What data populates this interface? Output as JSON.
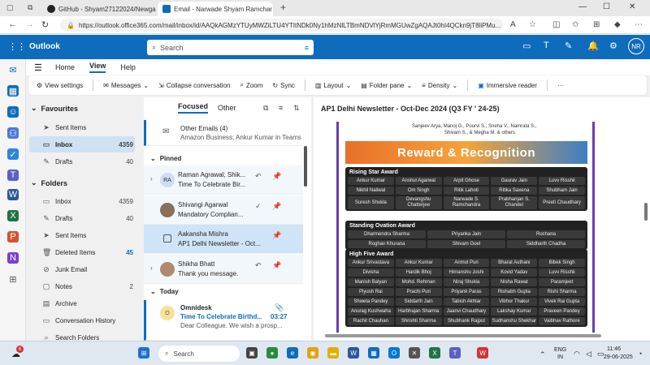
{
  "browser": {
    "tabs": [
      {
        "label": "GitHub - Shyam27122024/Newga",
        "icon": "github-icon"
      },
      {
        "label": "Email - Narwade Shyam Ramchar",
        "icon": "outlook-icon"
      }
    ],
    "new_tab": "+",
    "url": "https://outlook.office365.com/mail/inbox/id/AAQkAGMzYTUyMWZiLTU4YTItNDk0Ny1hMzNlLTBmNDVlYjRmMGUwZgAQAJt0hI4QCkn9jT8liPMu...",
    "window_controls": [
      "—",
      "☐",
      "✕"
    ]
  },
  "outlook": {
    "app_name": "Outlook",
    "search_placeholder": "Search",
    "avatar_initials": "NR",
    "ribbon_tabs": [
      "Home",
      "View",
      "Help"
    ],
    "active_ribbon_tab": "View",
    "ribbon_buttons": [
      "View settings",
      "Messages",
      "Collapse conversation",
      "Zoom",
      "Sync",
      "Layout",
      "Folder pane",
      "Density",
      "Immersive reader"
    ],
    "more": "···"
  },
  "folders": {
    "favourites_title": "Favourites",
    "favourites": [
      {
        "label": "Sent Items",
        "count": ""
      },
      {
        "label": "Inbox",
        "count": "4359"
      },
      {
        "label": "Drafts",
        "count": "40"
      }
    ],
    "folders_title": "Folders",
    "folders": [
      {
        "label": "Inbox",
        "count": "4359"
      },
      {
        "label": "Drafts",
        "count": "40"
      },
      {
        "label": "Sent Items",
        "count": ""
      },
      {
        "label": "Deleted Items",
        "count": "45"
      },
      {
        "label": "Junk Email",
        "count": ""
      },
      {
        "label": "Notes",
        "count": "2"
      },
      {
        "label": "Archive",
        "count": ""
      },
      {
        "label": "Conversation History",
        "count": ""
      },
      {
        "label": "Search Folders",
        "count": ""
      }
    ]
  },
  "message_list": {
    "tabs": [
      "Focused",
      "Other"
    ],
    "other_emails": {
      "sender": "Other Emails (4)",
      "preview": "Amazon Business; Ankur Kumar in Teams"
    },
    "pinned_label": "Pinned",
    "pinned": [
      {
        "sender": "Raman Agrawal; Shik...",
        "subject": "Time To Celebrate Bir...",
        "initials": "RA"
      },
      {
        "sender": "Shivangi Agarwal",
        "subject": "Mandatory Complian...",
        "initials": ""
      },
      {
        "sender": "Aakansha Mishra",
        "subject": "AP1 Delhi Newsletter - Oct...",
        "initials": ""
      },
      {
        "sender": "Shikha Bhatt",
        "subject": "Thank you message.",
        "initials": ""
      }
    ],
    "today_label": "Today",
    "today": [
      {
        "sender": "Omnidesk",
        "subject": "Time To Celebrate Birthd...",
        "time": "03:27",
        "preview": "Dear Colleague. We wish a prosp...",
        "initials": "O"
      }
    ]
  },
  "reader": {
    "title": "AP1 Delhi Newsletter - Oct-Dec 2024 (Q3 FY ' 24-25)",
    "top_names": [
      "Sanjeev Arya, Manoj G., Poorvi S., Sneha V., Namrata S.,",
      "Shivam S., & Megha M. & others"
    ],
    "banner": "Reward & Recognition",
    "rising_star": {
      "title": "Rising Star Award",
      "names": [
        "Ankur Kumar",
        "Anshul Agarwal",
        "Arpit Ghose",
        "Gaurav Jain",
        "Luvv Risshii",
        "Nikhil Naliwal",
        "Om Singh",
        "Ritik Lahoti",
        "Ritika Saxena",
        "Shubham Jain",
        "Suresh Shukla",
        "Devangshu Chatterjee",
        "Narwade S. Ramchandra",
        "Prabhanjan S. Chandel",
        "Preeti Chaudhary"
      ]
    },
    "standing_ovation": {
      "title": "Standing Ovation Award",
      "names": [
        "Dharmendra Sharma",
        "Priyanka Jain",
        "Rochana",
        "Roghav Khurana",
        "Shivam Goel",
        "Siddharth Chadha"
      ]
    },
    "high_five": {
      "title": "High Five Award",
      "names": [
        "Ankur Srivastava",
        "Ankur Kumar",
        "Anmol Puri",
        "Bharat Authani",
        "Bibek Singh",
        "Divisha",
        "Hardik Bhoj",
        "Himanshu Joshi",
        "Kovid Yadav",
        "Luvv Risshii",
        "Manish Balyan",
        "Mohd. Rehman",
        "Niraj Shukla",
        "Nisha Rawat",
        "Paramjeet",
        "Piyush Rai",
        "Prachi Puri",
        "Priyank Paras",
        "Rishabh Gupta",
        "Rishi Sharma",
        "Shweta Pandey",
        "Siddarth Jain",
        "Tabish Akhtar",
        "Vibhor Thakur",
        "Vivek Rai Gupta",
        "Anurag Kushwaha",
        "Harbhajan Sharma",
        "Jaanvi Chaudhary",
        "Lakshay Kumar",
        "Praveen Pandey",
        "Rachit Chauhan",
        "Shrishti Sharma",
        "Shubhank Rajput",
        "Sudhanshu Shekhar",
        "Vaibhav Rathore"
      ]
    }
  },
  "taskbar": {
    "notification_count": "6",
    "search_placeholder": "Search",
    "lang": "ENG",
    "region": "IN",
    "time": "11:46",
    "date": "29-06-2025"
  },
  "colors": {
    "brand": "#0f6cbd",
    "selection": "#cfe1f3"
  }
}
